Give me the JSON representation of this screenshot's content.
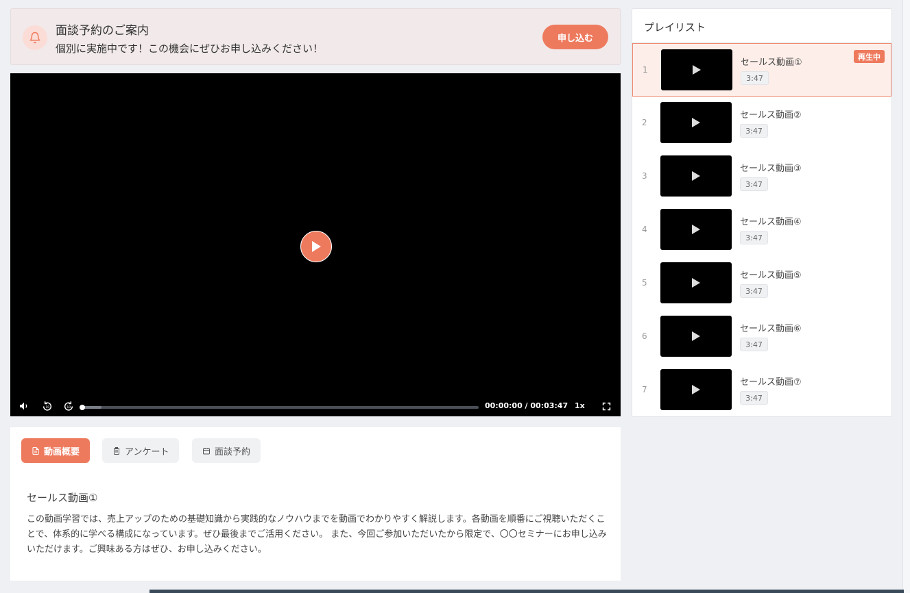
{
  "banner": {
    "icon": "bell-icon",
    "title": "面談予約のご案内",
    "subtitle": "個別に実施中です！この機会にぜひお申し込みください！",
    "apply_label": "申し込む"
  },
  "player": {
    "time_display": "00:00:00 / 00:03:47",
    "speed_label": "1x",
    "progress_fraction": 0,
    "buffered_fraction": 0.05
  },
  "tabs": [
    {
      "label": "動画概要",
      "icon": "document-icon",
      "active": true
    },
    {
      "label": "アンケート",
      "icon": "clipboard-icon",
      "active": false
    },
    {
      "label": "面談予約",
      "icon": "calendar-icon",
      "active": false
    }
  ],
  "content": {
    "title": "セールス動画①",
    "body": "この動画学習では、売上アップのための基礎知識から実践的なノウハウまでを動画でわかりやすく解説します。各動画を順番にご視聴いただくことで、体系的に学べる構成になっています。ぜひ最後までご活用ください。 また、今回ご参加いただいたから限定で、〇〇セミナーにお申し込みいただけます。ご興味ある方はぜひ、お申し込みください。"
  },
  "playlist": {
    "title": "プレイリスト",
    "now_playing_label": "再生中",
    "items": [
      {
        "number": "1",
        "title": "セールス動画①",
        "duration": "3:47"
      },
      {
        "number": "2",
        "title": "セールス動画②",
        "duration": "3:47"
      },
      {
        "number": "3",
        "title": "セールス動画③",
        "duration": "3:47"
      },
      {
        "number": "4",
        "title": "セールス動画④",
        "duration": "3:47"
      },
      {
        "number": "5",
        "title": "セールス動画⑤",
        "duration": "3:47"
      },
      {
        "number": "6",
        "title": "セールス動画⑥",
        "duration": "3:47"
      },
      {
        "number": "7",
        "title": "セールス動画⑦",
        "duration": "3:47"
      }
    ]
  },
  "colors": {
    "accent": "#ee7a5e",
    "banner_bg": "#f1e9ea",
    "active_item_bg": "#fdeee9"
  }
}
